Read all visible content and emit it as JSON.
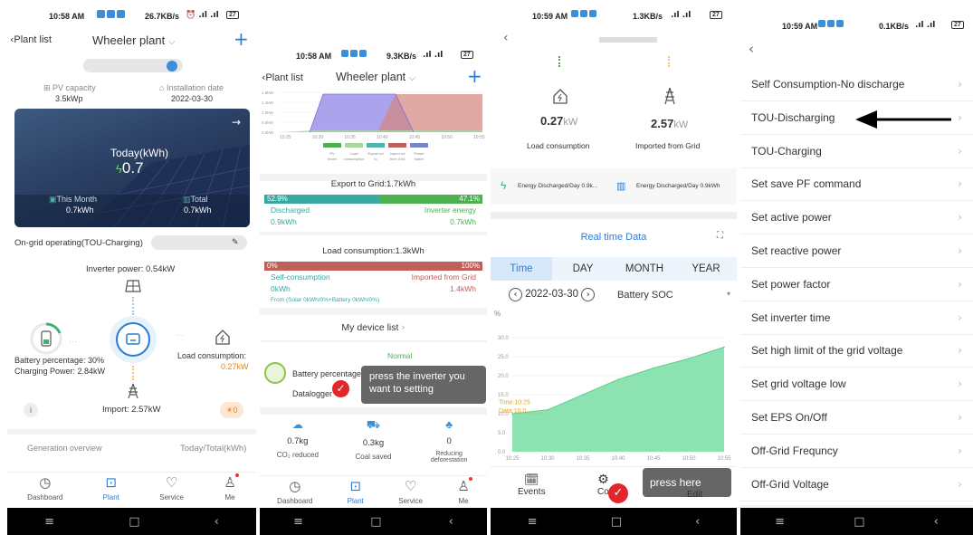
{
  "p1": {
    "status": {
      "time": "10:58 AM",
      "right": "26.7KB/s",
      "batt": "27"
    },
    "header": {
      "back": "Plant list",
      "plant": "Wheeler plant"
    },
    "pv_capacity": {
      "label": "PV capacity",
      "value": "3.5kWp"
    },
    "install_date": {
      "label": "Installation date",
      "value": "2022-03-30"
    },
    "today": {
      "label": "Today(kWh)",
      "value": "0.7"
    },
    "month": {
      "label": "This Month",
      "value": "0.7kWh"
    },
    "total": {
      "label": "Total",
      "value": "0.7kWh"
    },
    "operating": "On-grid operating(TOU-Charging)",
    "inverter_power": "Inverter power: 0.54kW",
    "battery_pct": "Battery percentage: 30%",
    "charging_power": "Charging Power: 2.84kW",
    "load_label": "Load consumption:",
    "load_value": "0.27kW",
    "import": "Import: 2.57kW",
    "alarm_count": "0",
    "gen_overview": "Generation overview",
    "today_total": "Today/Total(kWh)",
    "tabs": [
      "Dashboard",
      "Plant",
      "Service",
      "Me"
    ]
  },
  "p2": {
    "status": {
      "time": "10:58 AM",
      "right": "9.3KB/s",
      "batt": "27"
    },
    "header": {
      "back": "Plant list",
      "plant": "Wheeler plant"
    },
    "chart_data": {
      "type": "area",
      "x": [
        "10:25",
        "10:30",
        "10:35",
        "10:40",
        "10:45",
        "10:50",
        "10:55"
      ],
      "y_ticks": [
        "1.6kW",
        "1.4kW",
        "1.0kW",
        "0.5kW",
        "0.0kW"
      ],
      "legend": [
        "PV Invert",
        "Load consumption",
        "Export ed to",
        "Import ed from Grid",
        "Power batter"
      ],
      "colors": [
        "#4caf50",
        "#a8d8a0",
        "#4db6ac",
        "#c0605a",
        "#7986cb"
      ]
    },
    "export_title": "Export to Grid:1.7kWh",
    "export_left_pct": "52.9%",
    "export_right_pct": "47.1%",
    "export_left_label": "Discharged",
    "export_right_label": "Inverter energy",
    "export_left_val": "0.9kWh",
    "export_right_val": "0.7kWh",
    "load_title": "Load consumption:1.3kWh",
    "load_left_pct": "0%",
    "load_right_pct": "100%",
    "load_left_label": "Self-consumption",
    "load_right_label": "Imported from Grid",
    "load_left_val": "0kWh",
    "load_right_val": "1.4kWh",
    "load_from": "From (Solar 0kWh/0%+Battery 0kWh/0%)",
    "device_list": "My device list",
    "normal": "Normal",
    "battery_pct": "Battery percentage",
    "datalogger": "Datalogger",
    "tooltip": "press the inverter you want to setting",
    "co2_val": "0.7kg",
    "co2_label": "CO₂ reduced",
    "coal_val": "0.3kg",
    "coal_label": "Coal saved",
    "defor_val": "0",
    "defor_label": "Reducing deforestation",
    "tabs": [
      "Dashboard",
      "Plant",
      "Service",
      "Me"
    ]
  },
  "p3": {
    "status": {
      "time": "10:59 AM",
      "right": "1.3KB/s",
      "batt": "27"
    },
    "load_val": "0.27",
    "load_unit": "kW",
    "load_label": "Load consumption",
    "import_val": "2.57",
    "import_unit": "kW",
    "import_label": "Imported from Grid",
    "discharged_left": "Energy Discharged/Day 0.9k...",
    "discharged_right": "Energy Discharged/Day 0.9kWh",
    "realtime": "Real time Data",
    "tabs": [
      "Time",
      "DAY",
      "MONTH",
      "YEAR"
    ],
    "date": "2022-03-30",
    "select": "Battery SOC",
    "unit": "%",
    "chart_data": {
      "type": "area",
      "x": [
        "10:25",
        "10:30",
        "10:35",
        "10:40",
        "10:45",
        "10:50",
        "10:55"
      ],
      "values": [
        10,
        11,
        15,
        19,
        22,
        24.5,
        27.5
      ],
      "ylim": [
        0,
        30
      ],
      "y_ticks": [
        "30.0",
        "25.0",
        "20.0",
        "15.0",
        "10.0",
        "5.0",
        "0.0"
      ],
      "tooltip_time": "Time:10:25",
      "tooltip_data": "Data:10.0"
    },
    "bottom": [
      "Events",
      "Co",
      "Edit"
    ],
    "press_here": "press here"
  },
  "p4": {
    "status": {
      "time": "10:59 AM",
      "right": "0.1KB/s",
      "batt": "27"
    },
    "items": [
      "Self Consumption-No discharge",
      "TOU-Discharging",
      "TOU-Charging",
      "Set save PF command",
      "Set active power",
      "Set reactive power",
      "Set power factor",
      "Set inverter time",
      "Set high limit of the grid voltage",
      "Set grid voltage low",
      "Set EPS On/Off",
      "Off-Grid Frequncy",
      "Off-Grid Voltage"
    ]
  },
  "nav": {
    "menu": "≡",
    "home": "□",
    "back": "‹"
  }
}
